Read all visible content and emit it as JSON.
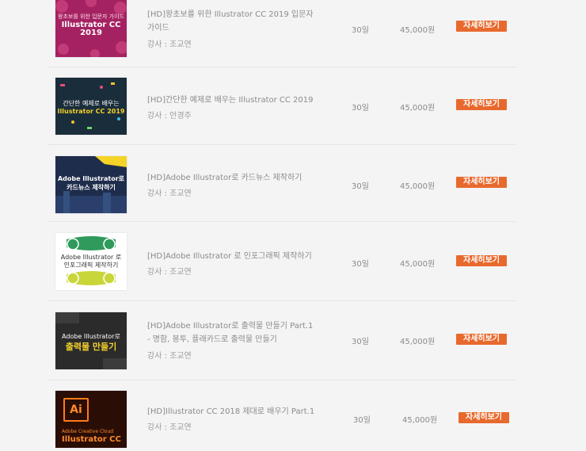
{
  "courses": [
    {
      "thumb_lines": [
        "왕초보를 위한 입문자 가이드",
        "Illustrator CC 2019"
      ],
      "title": "[HD]왕초보를 위한 Illustrator CC 2019 입문자 가이드",
      "teacher": "강사 : 조교연",
      "days": "30일",
      "price": "45,000원",
      "button": "자세히보기"
    },
    {
      "thumb_lines": [
        "간단한 예제로 배우는",
        "Illustrator CC 2019"
      ],
      "title": "[HD]간단한 예제로 배우는 Illustrator CC 2019",
      "teacher": "강사 : 안경주",
      "days": "30일",
      "price": "45,000원",
      "button": "자세히보기"
    },
    {
      "thumb_lines": [
        "Adobe Illustrator로",
        "카드뉴스 제작하기"
      ],
      "title": "[HD]Adobe Illustrator로 카드뉴스 제작하기",
      "teacher": "강사 : 조교연",
      "days": "30일",
      "price": "45,000원",
      "button": "자세히보기"
    },
    {
      "thumb_lines": [
        "Adobe Illustrator 로",
        "인포그래픽 제작하기"
      ],
      "title": "[HD]Adobe Illustrator 로 인포그래픽 제작하기",
      "teacher": "강사 : 조교연",
      "days": "30일",
      "price": "45,000원",
      "button": "자세히보기"
    },
    {
      "thumb_lines": [
        "Adobe Illustrator로",
        "출력물 만들기"
      ],
      "title": "[HD]Adobe Illustrator로 출력물 만들기 Part.1 - 명함, 봉투, 플래카드로 출력물 만들기",
      "teacher": "강사 : 조교연",
      "days": "30일",
      "price": "45,000원",
      "button": "자세히보기"
    },
    {
      "thumb_lines": [
        "Ai",
        "Adobe Creative Cloud",
        "Illustrator CC"
      ],
      "title": "[HD]Illustrator CC 2018 제대로 배우기 Part.1",
      "teacher": "강사 : 조교연",
      "days": "30일",
      "price": "45,000원",
      "button": "자세히보기"
    }
  ],
  "colors": {
    "button": "#e8692d",
    "background": "#f4f4f5",
    "thumb1": "#a52262",
    "thumb2": "#1a2d3a",
    "thumb3": "#1f2d4c",
    "thumb4": "#ffffff",
    "thumb5": "#2b2b2b",
    "thumb6": "#2a0e06"
  }
}
